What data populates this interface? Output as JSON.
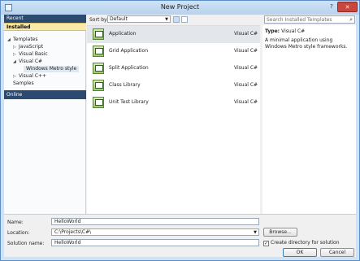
{
  "window": {
    "title": "New Project",
    "help_glyph": "?",
    "close_glyph": "✕"
  },
  "nav": {
    "recent": "Recent",
    "installed": "Installed",
    "tree": [
      {
        "label": "Templates",
        "arrow": "◢"
      },
      {
        "label": "JavaScript",
        "arrow": "▷"
      },
      {
        "label": "Visual Basic",
        "arrow": "▷"
      },
      {
        "label": "Visual C#",
        "arrow": "◢"
      },
      {
        "label": "Windows Metro style",
        "arrow": ""
      },
      {
        "label": "Visual C++",
        "arrow": "▷"
      },
      {
        "label": "Samples",
        "arrow": ""
      }
    ],
    "online": "Online"
  },
  "toolbar": {
    "sort_label": "Sort by:",
    "sort_value": "Default",
    "search_placeholder": "Search Installed Templates",
    "search_icon": "search-icon"
  },
  "templates": [
    {
      "name": "Application",
      "lang": "Visual C#",
      "selected": true
    },
    {
      "name": "Grid Application",
      "lang": "Visual C#"
    },
    {
      "name": "Split Application",
      "lang": "Visual C#"
    },
    {
      "name": "Class Library",
      "lang": "Visual C#"
    },
    {
      "name": "Unit Test Library",
      "lang": "Visual C#"
    }
  ],
  "details": {
    "type_label": "Type:",
    "type_value": "Visual C#",
    "description": "A minimal application using Windows Metro style frameworks."
  },
  "form": {
    "name_label": "Name:",
    "name_value": "HelloWorld",
    "location_label": "Location:",
    "location_value": "C:\\Projects\\C#\\",
    "solution_label": "Solution name:",
    "solution_value": "HelloWorld",
    "browse": "Browse...",
    "create_dir": "Create directory for solution",
    "create_dir_checked": true,
    "ok": "OK",
    "cancel": "Cancel"
  },
  "colors": {
    "accent": "#2c4a6f",
    "installed_highlight": "#fbe9a8",
    "close": "#c8463d"
  }
}
